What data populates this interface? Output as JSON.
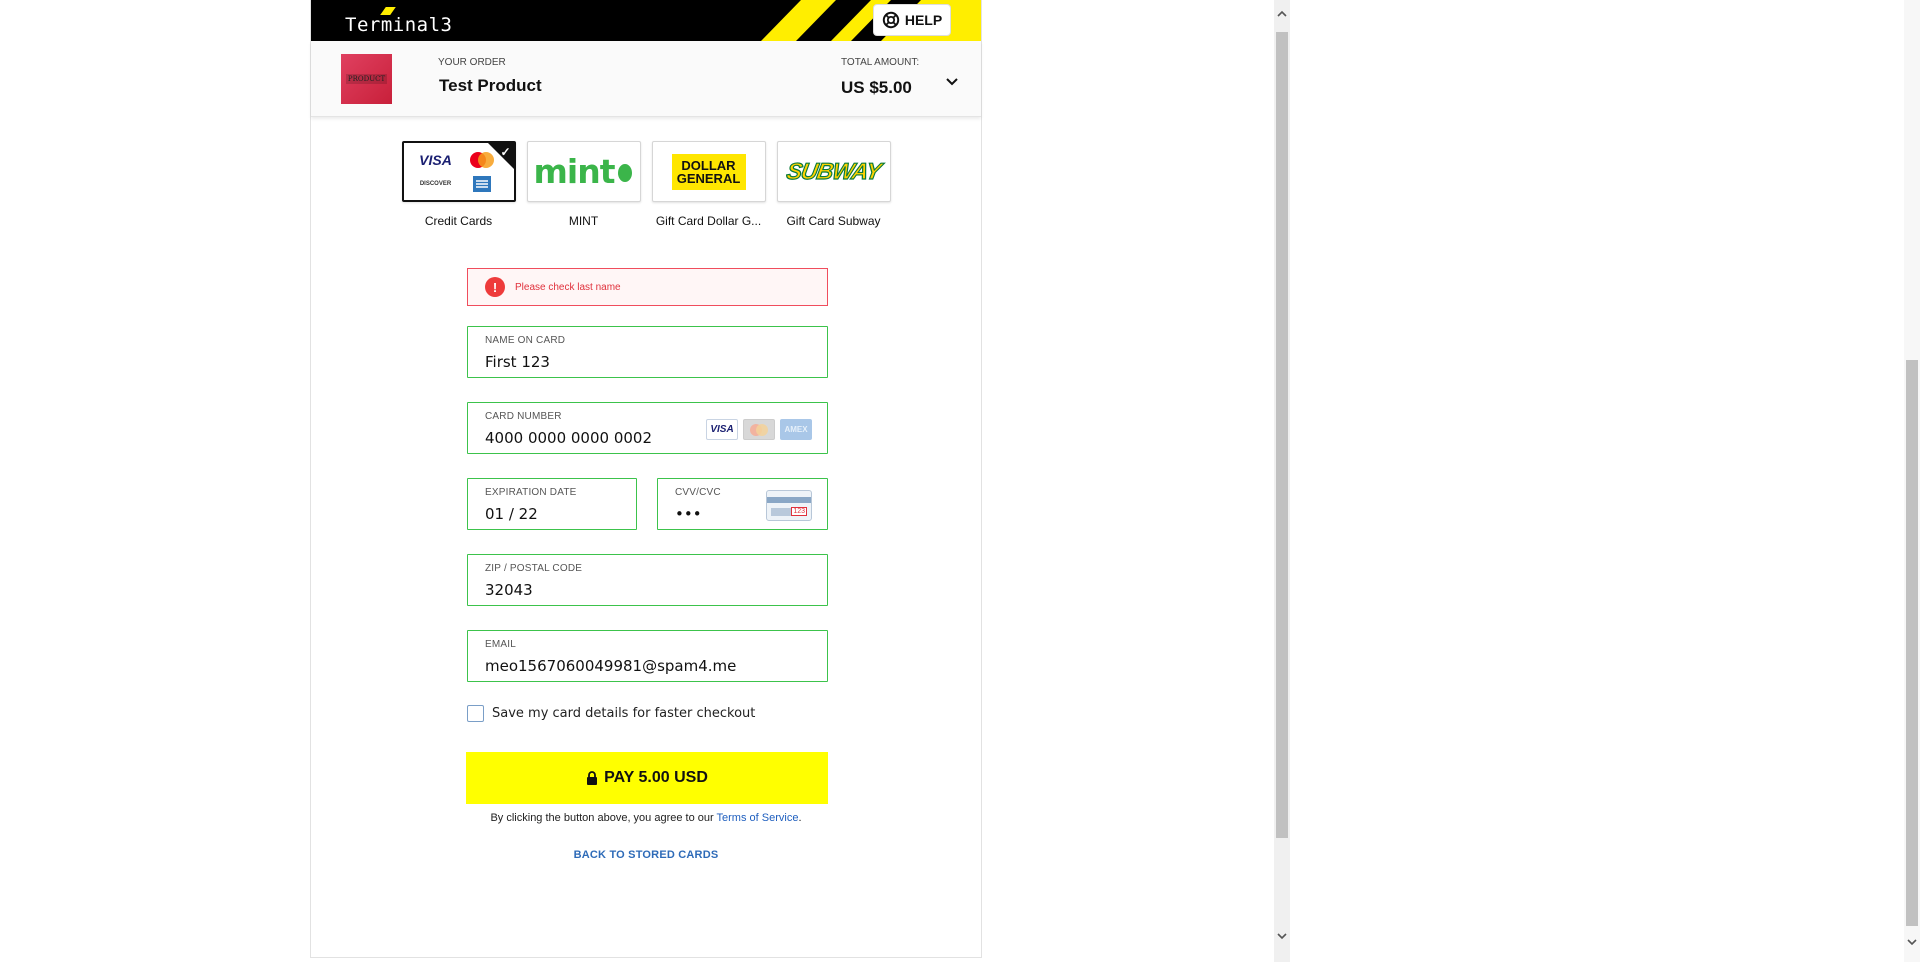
{
  "header": {
    "brand": "Terminal3",
    "help_label": "HELP"
  },
  "order": {
    "your_order_label": "YOUR ORDER",
    "product_name": "Test Product",
    "total_label": "TOTAL AMOUNT:",
    "total_amount": "US $5.00",
    "thumbnail_text": "PRODUCT"
  },
  "payment_methods": [
    {
      "label": "Credit Cards",
      "selected": true
    },
    {
      "label": "MINT",
      "selected": false
    },
    {
      "label": "Gift Card Dollar G...",
      "selected": false
    },
    {
      "label": "Gift Card Subway",
      "selected": false
    }
  ],
  "logos": {
    "visa": "VISA",
    "discover": "DISCOVER",
    "mint": "mint",
    "dollar_general_line1": "DOLLAR",
    "dollar_general_line2": "GENERAL",
    "subway": "SUBWAY",
    "amex": "AMEX"
  },
  "error": {
    "icon": "!",
    "message": "Please check last name"
  },
  "form": {
    "name_label": "NAME ON CARD",
    "name_value": "First 123",
    "card_label": "CARD NUMBER",
    "card_value": "4000 0000 0000 0002",
    "exp_label": "EXPIRATION DATE",
    "exp_value": "01 / 22",
    "cvv_label": "CVV/CVC",
    "cvv_value": "•••",
    "cvv_hint": "123",
    "zip_label": "ZIP / POSTAL CODE",
    "zip_value": "32043",
    "email_label": "EMAIL",
    "email_value": "meo1567060049981@spam4.me",
    "save_label": "Save my card details for faster checkout"
  },
  "pay": {
    "label": "PAY  5.00 USD"
  },
  "terms": {
    "prefix": "By clicking the button above, you agree to our ",
    "link": "Terms of Service",
    "suffix": "."
  },
  "back_link": "BACK TO STORED CARDS",
  "colors": {
    "accent_yellow": "#ffff00",
    "field_valid": "#3cc34b",
    "error_red": "#e0313c",
    "link_blue": "#2e6bb8"
  }
}
